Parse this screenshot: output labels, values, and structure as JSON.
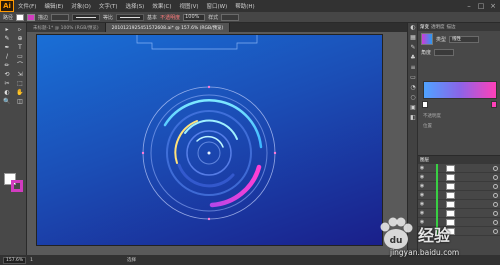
{
  "app": {
    "logo": "Ai"
  },
  "menu": [
    "文件(F)",
    "编辑(E)",
    "对象(O)",
    "文字(T)",
    "选择(S)",
    "效果(C)",
    "视图(V)",
    "窗口(W)",
    "帮助(H)"
  ],
  "control_bar": {
    "mode_label": "路径",
    "stroke_label": "描边",
    "stroke_weight": "pt",
    "stroke_profile": "等比",
    "brush": "基本",
    "opacity_label": "不透明度",
    "opacity_value": "100%",
    "style_label": "样式"
  },
  "tabs": [
    {
      "label": "未标题-1* @ 100% (RGB/预览)"
    },
    {
      "label": "2010121925451572608.ai* @ 157.6% (RGB/预览)",
      "active": true
    }
  ],
  "tools": [
    "▸",
    "▹",
    "✎",
    "⊕",
    "✒",
    "T",
    "/",
    "▭",
    "✏",
    "⌒",
    "⟲",
    "⇲",
    "✂",
    "⬚",
    "◐",
    "✋",
    "🔍",
    "◫"
  ],
  "gradient_panel": {
    "tabs": [
      "渐变",
      "透明度",
      "描边"
    ],
    "type_label": "类型",
    "type_value": "线性",
    "angle_label": "角度",
    "location_label": "位置",
    "opacity_label": "不透明度"
  },
  "layers": {
    "tab": "图层",
    "rows": 8
  },
  "status": {
    "zoom": "157.6%",
    "page": "1",
    "tool": "选择"
  },
  "watermark": {
    "brand": "经验",
    "url": "jingyan.baidu.com"
  },
  "colors": {
    "accent_pink": "#d23cc0",
    "gradient_start": "#4fa3ff",
    "gradient_end": "#ff40b8",
    "artboard_top": "#1a6fd6",
    "artboard_bottom": "#1a1f8a"
  }
}
